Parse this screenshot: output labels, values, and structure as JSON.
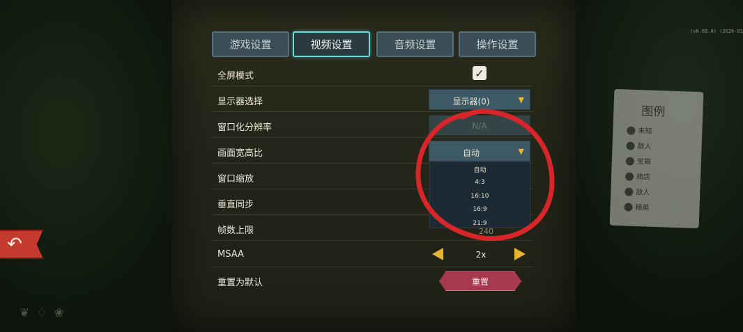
{
  "tabs": [
    {
      "label": "游戏设置",
      "active": false
    },
    {
      "label": "视频设置",
      "active": true
    },
    {
      "label": "音频设置",
      "active": false
    },
    {
      "label": "操作设置",
      "active": false
    }
  ],
  "settings": {
    "fullscreen": {
      "label": "全屏模式",
      "checked": true
    },
    "monitor": {
      "label": "显示器选择",
      "value": "显示器(0)"
    },
    "windowed_resolution": {
      "label": "窗口化分辨率",
      "value": "N/A"
    },
    "aspect_ratio": {
      "label": "画面宽高比",
      "value": "自动",
      "options": [
        "自动",
        "4:3",
        "16:10",
        "16:9",
        "21:9"
      ]
    },
    "window_scale": {
      "label": "窗口缩放"
    },
    "vsync": {
      "label": "垂直同步"
    },
    "fps_limit": {
      "label": "帧数上限",
      "value": "240"
    },
    "msaa": {
      "label": "MSAA",
      "value": "2x"
    },
    "reset": {
      "label": "重置为默认",
      "button_label": "重置"
    }
  },
  "legend": {
    "title": "图例",
    "items": [
      "未知",
      "敌人",
      "宝箱",
      "商店",
      "敌人",
      "精英"
    ]
  },
  "colors": {
    "accent_active": "#5fe1e4",
    "arrow_yellow": "#e7b42c",
    "reset_red": "#a4394f",
    "annotation_red": "#d8252a",
    "back_button": "#c53a2e"
  },
  "icons": {
    "back": "back-arrow-icon",
    "checkbox": "check-icon",
    "dropdown": "triangle-down-icon",
    "stepper_left": "triangle-left-icon",
    "stepper_right": "triangle-right-icon"
  }
}
